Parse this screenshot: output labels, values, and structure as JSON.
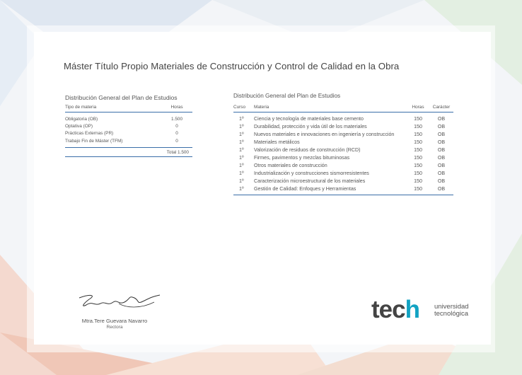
{
  "title": "Máster Título Propio Materiales de Construcción y Control de Calidad en la Obra",
  "summary": {
    "title": "Distribución General del Plan de Estudios",
    "col_type": "Tipo de materia",
    "col_hours": "Horas",
    "rows": [
      {
        "type": "Obligatoria (OB)",
        "hours": "1.500"
      },
      {
        "type": "Optativa (OP)",
        "hours": "0"
      },
      {
        "type": "Prácticas Externas (PR)",
        "hours": "0"
      },
      {
        "type": "Trabajo Fin de Máster (TFM)",
        "hours": "0"
      }
    ],
    "total": "Total 1.500"
  },
  "detail": {
    "title": "Distribución General del Plan de Estudios",
    "headers": {
      "curso": "Curso",
      "materia": "Materia",
      "horas": "Horas",
      "caracter": "Carácter"
    },
    "rows": [
      {
        "curso": "1º",
        "materia": "Ciencia y tecnología de materiales base cemento",
        "horas": "150",
        "caracter": "OB"
      },
      {
        "curso": "1º",
        "materia": "Durabilidad, protección y vida útil de los materiales",
        "horas": "150",
        "caracter": "OB"
      },
      {
        "curso": "1º",
        "materia": "Nuevos materiales e innovaciones en ingeniería y construcción",
        "horas": "150",
        "caracter": "OB"
      },
      {
        "curso": "1º",
        "materia": "Materiales metálicos",
        "horas": "150",
        "caracter": "OB"
      },
      {
        "curso": "1º",
        "materia": "Valorización de residuos de construcción (RCD)",
        "horas": "150",
        "caracter": "OB"
      },
      {
        "curso": "1º",
        "materia": "Firmes, pavimentos y mezclas bituminosas",
        "horas": "150",
        "caracter": "OB"
      },
      {
        "curso": "1º",
        "materia": "Otros materiales de construcción",
        "horas": "150",
        "caracter": "OB"
      },
      {
        "curso": "1º",
        "materia": "Industrialización y construcciones sismorresistentes",
        "horas": "150",
        "caracter": "OB"
      },
      {
        "curso": "1º",
        "materia": "Caracterización microestructural de los materiales",
        "horas": "150",
        "caracter": "OB"
      },
      {
        "curso": "1º",
        "materia": "Gestión de Calidad: Enfoques y Herramientas",
        "horas": "150",
        "caracter": "OB"
      }
    ]
  },
  "signature": {
    "name": "Mtra.Tere Guevara Navarro",
    "role": "Rectora"
  },
  "logo": {
    "wordmark_start": "tec",
    "wordmark_end": "h",
    "line1": "universidad",
    "line2": "tecnológica"
  },
  "colors": {
    "accent_line": "#3a6ea8",
    "logo_h": "#12a3c3",
    "logo_text": "#444444"
  }
}
